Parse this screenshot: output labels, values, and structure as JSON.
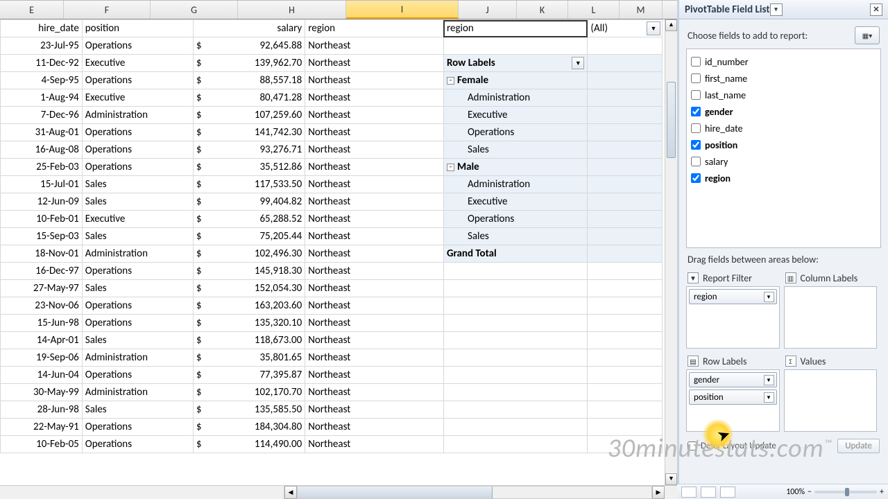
{
  "columns": [
    "E",
    "F",
    "G",
    "H",
    "I",
    "J",
    "K",
    "L",
    "M"
  ],
  "headers": {
    "E": "hire_date",
    "F": "position",
    "G": "salary",
    "H": "region"
  },
  "rows": [
    {
      "date": "23-Jul-95",
      "pos": "Operations",
      "sal": "92,645.88",
      "reg": "Northeast"
    },
    {
      "date": "11-Dec-92",
      "pos": "Executive",
      "sal": "139,962.70",
      "reg": "Northeast"
    },
    {
      "date": "4-Sep-95",
      "pos": "Operations",
      "sal": "88,557.18",
      "reg": "Northeast"
    },
    {
      "date": "1-Aug-94",
      "pos": "Executive",
      "sal": "80,471.28",
      "reg": "Northeast"
    },
    {
      "date": "7-Dec-96",
      "pos": "Administration",
      "sal": "107,259.60",
      "reg": "Northeast"
    },
    {
      "date": "31-Aug-01",
      "pos": "Operations",
      "sal": "141,742.30",
      "reg": "Northeast"
    },
    {
      "date": "16-Aug-08",
      "pos": "Operations",
      "sal": "93,276.71",
      "reg": "Northeast"
    },
    {
      "date": "25-Feb-03",
      "pos": "Operations",
      "sal": "35,512.86",
      "reg": "Northeast"
    },
    {
      "date": "15-Jul-01",
      "pos": "Sales",
      "sal": "117,533.50",
      "reg": "Northeast"
    },
    {
      "date": "12-Jun-09",
      "pos": "Sales",
      "sal": "99,404.82",
      "reg": "Northeast"
    },
    {
      "date": "10-Feb-01",
      "pos": "Executive",
      "sal": "65,288.52",
      "reg": "Northeast"
    },
    {
      "date": "15-Sep-03",
      "pos": "Sales",
      "sal": "75,205.44",
      "reg": "Northeast"
    },
    {
      "date": "18-Nov-01",
      "pos": "Administration",
      "sal": "102,496.30",
      "reg": "Northeast"
    },
    {
      "date": "16-Dec-97",
      "pos": "Operations",
      "sal": "145,918.30",
      "reg": "Northeast"
    },
    {
      "date": "27-May-97",
      "pos": "Sales",
      "sal": "152,054.30",
      "reg": "Northeast"
    },
    {
      "date": "23-Nov-06",
      "pos": "Operations",
      "sal": "163,203.60",
      "reg": "Northeast"
    },
    {
      "date": "15-Jun-98",
      "pos": "Operations",
      "sal": "135,320.10",
      "reg": "Northeast"
    },
    {
      "date": "14-Apr-01",
      "pos": "Sales",
      "sal": "118,673.00",
      "reg": "Northeast"
    },
    {
      "date": "19-Sep-06",
      "pos": "Administration",
      "sal": "35,801.65",
      "reg": "Northeast"
    },
    {
      "date": "14-Jun-04",
      "pos": "Operations",
      "sal": "77,395.87",
      "reg": "Northeast"
    },
    {
      "date": "30-May-99",
      "pos": "Administration",
      "sal": "102,170.70",
      "reg": "Northeast"
    },
    {
      "date": "28-Jun-98",
      "pos": "Sales",
      "sal": "135,585.50",
      "reg": "Northeast"
    },
    {
      "date": "22-May-91",
      "pos": "Operations",
      "sal": "184,304.80",
      "reg": "Northeast"
    },
    {
      "date": "10-Feb-05",
      "pos": "Operations",
      "sal": "114,490.00",
      "reg": "Northeast"
    }
  ],
  "currency": "$",
  "pivot": {
    "filter_field": "region",
    "filter_value": "(All)",
    "row_labels_hdr": "Row Labels",
    "groups": [
      {
        "name": "Female",
        "items": [
          "Administration",
          "Executive",
          "Operations",
          "Sales"
        ]
      },
      {
        "name": "Male",
        "items": [
          "Administration",
          "Executive",
          "Operations",
          "Sales"
        ]
      }
    ],
    "grand_total": "Grand Total"
  },
  "pane": {
    "title": "PivotTable Field List",
    "choose": "Choose fields to add to report:",
    "fields": [
      {
        "name": "id_number",
        "checked": false
      },
      {
        "name": "first_name",
        "checked": false
      },
      {
        "name": "last_name",
        "checked": false
      },
      {
        "name": "gender",
        "checked": true
      },
      {
        "name": "hire_date",
        "checked": false
      },
      {
        "name": "position",
        "checked": true
      },
      {
        "name": "salary",
        "checked": false
      },
      {
        "name": "region",
        "checked": true
      }
    ],
    "drag_label": "Drag fields between areas below:",
    "areas": {
      "report_filter": {
        "label": "Report Filter",
        "chips": [
          "region"
        ]
      },
      "column_labels": {
        "label": "Column Labels",
        "chips": []
      },
      "row_labels": {
        "label": "Row Labels",
        "chips": [
          "gender",
          "position"
        ]
      },
      "values": {
        "label": "Values",
        "chips": []
      }
    },
    "defer": "Defer Layout Update",
    "update": "Update"
  },
  "status": {
    "zoom": "100%"
  },
  "watermark": "30minutestats.com",
  "watermark_tm": "™"
}
